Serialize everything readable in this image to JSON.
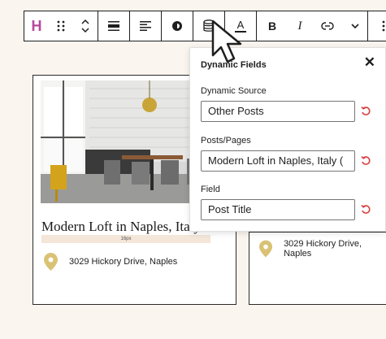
{
  "toolbar": {
    "buttons": [
      {
        "name": "block-type",
        "icon": "heading-h-icon",
        "label": "H"
      },
      {
        "name": "drag-handle",
        "icon": "drag-handle-icon"
      },
      {
        "name": "move-up-down",
        "icon": "chevron-up-down-icon"
      },
      {
        "name": "align",
        "icon": "align-icon"
      },
      {
        "name": "text-align",
        "icon": "text-align-left-icon"
      },
      {
        "name": "styles",
        "icon": "contrast-icon"
      },
      {
        "name": "dynamic-data",
        "icon": "database-icon"
      },
      {
        "name": "text-color",
        "icon": "text-color-icon",
        "label": "A"
      },
      {
        "name": "bold",
        "icon": "bold-icon",
        "label": "B"
      },
      {
        "name": "italic",
        "icon": "italic-icon",
        "label": "I"
      },
      {
        "name": "link",
        "icon": "link-icon"
      },
      {
        "name": "more-formatting",
        "icon": "chevron-down-icon"
      },
      {
        "name": "options",
        "icon": "more-vertical-icon"
      }
    ]
  },
  "cards": [
    {
      "title": "Modern Loft in Naples, Italy",
      "spacing_label": "16px",
      "address": "3029 Hickory Drive, Naples"
    },
    {
      "address": "3029 Hickory Drive, Naples"
    }
  ],
  "popover": {
    "title": "Dynamic Fields",
    "close_icon": "close-icon",
    "fields": [
      {
        "label": "Dynamic Source",
        "value": "Other Posts"
      },
      {
        "label": "Posts/Pages",
        "value": "Modern Loft in Naples, Italy ("
      },
      {
        "label": "Field",
        "value": "Post Title"
      }
    ],
    "reset_icon": "reset-icon"
  },
  "colors": {
    "background": "#fbf5ef",
    "brand": "#b8479b",
    "pin": "#d9c274",
    "reset": "#d94040",
    "spacing": "#f4e6d8"
  }
}
